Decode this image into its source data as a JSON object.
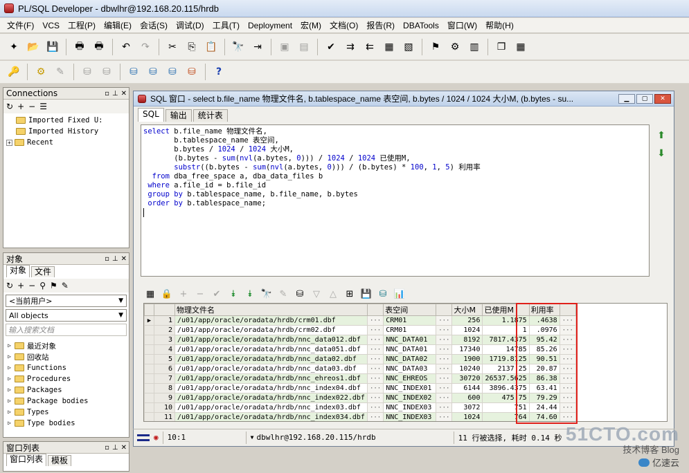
{
  "window": {
    "title": "PL/SQL Developer - dbwlhr@192.168.20.115/hrdb"
  },
  "menu": [
    "文件(F)",
    "VCS",
    "工程(P)",
    "编辑(E)",
    "会话(S)",
    "调试(D)",
    "工具(T)",
    "Deployment",
    "宏(M)",
    "文档(O)",
    "报告(R)",
    "DBATools",
    "窗口(W)",
    "帮助(H)"
  ],
  "toolbar_icons": {
    "row1": [
      "new-icon",
      "open-icon",
      "save-icon",
      "print-icon",
      "print-preview-icon",
      "undo-icon",
      "redo-icon",
      "cut-icon",
      "copy-icon",
      "paste-icon",
      "find-icon",
      "find-next-icon",
      "execute-icon",
      "run-icon",
      "compile-icon",
      "indent-icon",
      "unindent-icon",
      "comment-icon",
      "uncomment-icon",
      "explain-icon",
      "beautify-icon",
      "query-builder-icon",
      "window-list-icon",
      "cascade-icon"
    ],
    "row2": [
      "key-icon",
      "gear-icon",
      "break-icon",
      "commit-icon",
      "rollback-icon",
      "db-icon",
      "sql-icon",
      "run-db-icon",
      "help-icon"
    ]
  },
  "connections": {
    "title": "Connections",
    "items": [
      "Imported Fixed U:",
      "Imported History",
      "Recent"
    ]
  },
  "objects": {
    "title": "对象",
    "tabs": [
      "对象",
      "文件"
    ],
    "user_combo": "<当前用户>",
    "filter_combo": "All objects",
    "search_placeholder": "输入搜索文档",
    "items": [
      "最近对象",
      "回收站",
      "Functions",
      "Procedures",
      "Packages",
      "Package bodies",
      "Types",
      "Type bodies"
    ]
  },
  "window_list": {
    "title": "窗口列表",
    "tabs": [
      "窗口列表",
      "模板"
    ]
  },
  "sql_window": {
    "title": "SQL 窗口 - select b.file_name 物理文件名, b.tablespace_name 表空间, b.bytes / 1024 / 1024 大小M, (b.bytes - su...",
    "tabs": [
      "SQL",
      "输出",
      "统计表"
    ],
    "sql_lines": [
      "select b.file_name 物理文件名,",
      "       b.tablespace_name 表空间,",
      "       b.bytes / 1024 / 1024 大小M,",
      "       (b.bytes - sum(nvl(a.bytes, 0))) / 1024 / 1024 已使用M,",
      "       substr((b.bytes - sum(nvl(a.bytes, 0))) / (b.bytes) * 100, 1, 5) 利用率",
      "  from dba_free_space a, dba_data_files b",
      " where a.file_id = b.file_id",
      " group by b.tablespace_name, b.file_name, b.bytes",
      " order by b.tablespace_name;"
    ]
  },
  "result": {
    "columns": [
      "物理文件名",
      "表空间",
      "大小M",
      "已使用M",
      "利用率"
    ],
    "rows": [
      [
        "1",
        "/u01/app/oracle/oradata/hrdb/crm01.dbf",
        "CRM01",
        "256",
        "1.1875",
        ".4638"
      ],
      [
        "2",
        "/u01/app/oracle/oradata/hrdb/crm02.dbf",
        "CRM01",
        "1024",
        "1",
        ".0976"
      ],
      [
        "3",
        "/u01/app/oracle/oradata/hrdb/nnc_data012.dbf",
        "NNC_DATA01",
        "8192",
        "7817.4375",
        "95.42"
      ],
      [
        "4",
        "/u01/app/oracle/oradata/hrdb/nnc_data051.dbf",
        "NNC_DATA01",
        "17340",
        "14785",
        "85.26"
      ],
      [
        "5",
        "/u01/app/oracle/oradata/hrdb/nnc_data02.dbf",
        "NNC_DATA02",
        "1900",
        "1719.8125",
        "90.51"
      ],
      [
        "6",
        "/u01/app/oracle/oradata/hrdb/nnc_data03.dbf",
        "NNC_DATA03",
        "10240",
        "2137.25",
        "20.87"
      ],
      [
        "7",
        "/u01/app/oracle/oradata/hrdb/nnc_ehreos1.dbf",
        "NNC_EHREOS",
        "30720",
        "26537.5625",
        "86.38"
      ],
      [
        "8",
        "/u01/app/oracle/oradata/hrdb/nnc_index04.dbf",
        "NNC_INDEX01",
        "6144",
        "3896.4375",
        "63.41"
      ],
      [
        "9",
        "/u01/app/oracle/oradata/hrdb/nnc_index022.dbf",
        "NNC_INDEX02",
        "600",
        "475.75",
        "79.29"
      ],
      [
        "10",
        "/u01/app/oracle/oradata/hrdb/nnc_index03.dbf",
        "NNC_INDEX03",
        "3072",
        "751",
        "24.44"
      ],
      [
        "11",
        "/u01/app/oracle/oradata/hrdb/nnc_index034.dbf",
        "NNC_INDEX03",
        "1024",
        "764",
        "74.60"
      ]
    ]
  },
  "status": {
    "position": "10:1",
    "connection": "dbwlhr@192.168.20.115/hrdb",
    "message": "11 行被选择, 耗时 0.14 秒"
  },
  "watermark": {
    "site": "51CTO.com",
    "sub": "技术博客 Blog",
    "brand": "亿速云"
  },
  "colors": {
    "highlight_box": "#e0201a",
    "odd_row": "#e6f2de"
  }
}
